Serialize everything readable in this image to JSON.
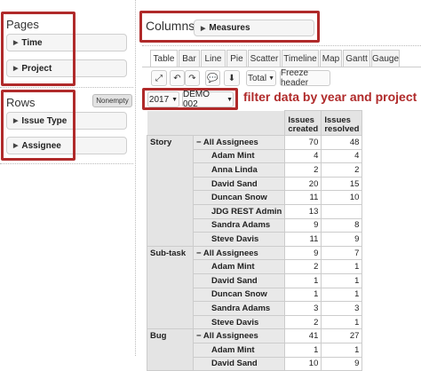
{
  "pages": {
    "title": "Pages",
    "items": [
      "Time",
      "Project"
    ]
  },
  "rows": {
    "title": "Rows",
    "nonempty_label": "Nonempty",
    "items": [
      "Issue Type",
      "Assignee"
    ]
  },
  "columns": {
    "title": "Columns",
    "items": [
      "Measures"
    ]
  },
  "tabs": [
    "Table",
    "Bar",
    "Line",
    "Pie",
    "Scatter",
    "Timeline",
    "Map",
    "Gantt",
    "Gauge"
  ],
  "toolbar": {
    "total_label": "Total",
    "freeze_label": "Freeze header"
  },
  "filters": {
    "year": "2017",
    "project": "DEMO 002",
    "annotation": "filter data by year and project"
  },
  "table": {
    "headers": [
      "Issues created",
      "Issues resolved"
    ],
    "groups": [
      {
        "type": "Story",
        "rows": [
          {
            "name": "All Assignees",
            "created": "70",
            "resolved": "48",
            "all": true
          },
          {
            "name": "Adam Mint",
            "created": "4",
            "resolved": "4"
          },
          {
            "name": "Anna Linda",
            "created": "2",
            "resolved": "2"
          },
          {
            "name": "David Sand",
            "created": "20",
            "resolved": "15"
          },
          {
            "name": "Duncan Snow",
            "created": "11",
            "resolved": "10"
          },
          {
            "name": "JDG REST Admin",
            "created": "13",
            "resolved": ""
          },
          {
            "name": "Sandra Adams",
            "created": "9",
            "resolved": "8"
          },
          {
            "name": "Steve Davis",
            "created": "11",
            "resolved": "9"
          }
        ]
      },
      {
        "type": "Sub-task",
        "rows": [
          {
            "name": "All Assignees",
            "created": "9",
            "resolved": "7",
            "all": true
          },
          {
            "name": "Adam Mint",
            "created": "2",
            "resolved": "1"
          },
          {
            "name": "David Sand",
            "created": "1",
            "resolved": "1"
          },
          {
            "name": "Duncan Snow",
            "created": "1",
            "resolved": "1"
          },
          {
            "name": "Sandra Adams",
            "created": "3",
            "resolved": "3"
          },
          {
            "name": "Steve Davis",
            "created": "2",
            "resolved": "1"
          }
        ]
      },
      {
        "type": "Bug",
        "rows": [
          {
            "name": "All Assignees",
            "created": "41",
            "resolved": "27",
            "all": true
          },
          {
            "name": "Adam Mint",
            "created": "1",
            "resolved": "1"
          },
          {
            "name": "David Sand",
            "created": "10",
            "resolved": "9"
          }
        ]
      }
    ]
  },
  "colors": {
    "annotation_red": "#b02a2a"
  }
}
